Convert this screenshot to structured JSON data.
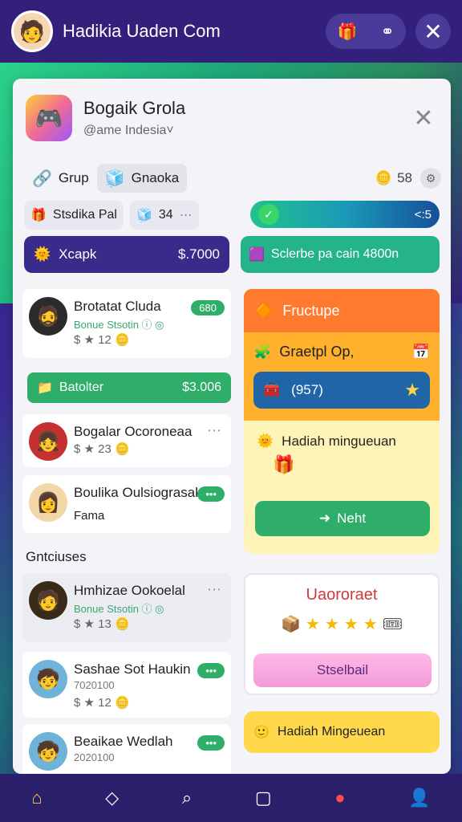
{
  "topbar": {
    "title": "Hadikia Uaden Com",
    "action_icons": [
      "gift-icon",
      "group-icon"
    ],
    "close_label": "✕"
  },
  "header": {
    "title": "Bogaik Grola",
    "subtitle": "@ame Indesia˅",
    "close_label": "✕"
  },
  "tabs": {
    "grup": "Grup",
    "gnaoka": "Gnaoka"
  },
  "coins": {
    "count": "58"
  },
  "row2": {
    "chip1": "Stsdika Pal",
    "chip2": "34",
    "bar_right": "<:5"
  },
  "actions": {
    "purple_label": "Xcapk",
    "purple_amount": "$.7000",
    "green_label": "Sclerbe pa cain 4800n"
  },
  "players": [
    {
      "name": "Brotatat Cluda",
      "sub": "Bonue Stsotin ⓘ ◎",
      "meta": "$ ★ 12 🪙",
      "badge": "680"
    },
    {
      "name": "Bogalar Ocoroneaa",
      "sub": "",
      "meta": "$ ★ 23 🪙",
      "badge": ""
    },
    {
      "name": "Boulika Oulsiograsak",
      "sub": "",
      "meta": "Fama",
      "badge": ""
    }
  ],
  "left_button": {
    "label": "Batolter",
    "amount": "$3.006"
  },
  "section": {
    "title": "Gntciuses"
  },
  "list": [
    {
      "name": "Hmhizae Ookoelal",
      "sub": "Bonue Stsotin ⓘ ◎",
      "meta": "$ ★ 13 🪙"
    },
    {
      "name": "Sashae Sot Haukin",
      "sub": "7020100",
      "meta": "$ ★ 12 🪙"
    },
    {
      "name": "Beaikae Wedlah",
      "sub": "2020100",
      "meta": "$ ★ ..."
    }
  ],
  "right_cards": {
    "orange_header": "Fructupe",
    "mid_title": "Graetpl Op,",
    "mid_bar": "(957)",
    "yellow_title": "Hadiah mingueuan",
    "next_label": "Neht",
    "white_title": "Uaororaet",
    "pink_label": "Stselbail",
    "bottom_banner": "Hadiah Mingeuean"
  },
  "bottom_nav": [
    "home-icon",
    "tag-icon",
    "search-icon",
    "square-icon",
    "dots-icon",
    "user-icon"
  ]
}
